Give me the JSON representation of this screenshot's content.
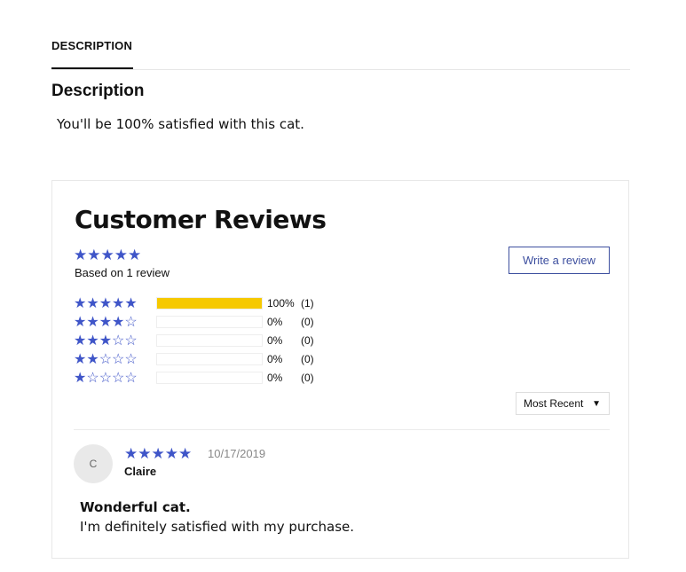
{
  "tabs": [
    {
      "label": "DESCRIPTION",
      "active": true
    }
  ],
  "description": {
    "heading": "Description",
    "text": "You'll be 100% satisfied with this cat."
  },
  "reviews": {
    "title": "Customer Reviews",
    "summary_stars": "★★★★★",
    "rating": 5,
    "based_on": "Based on 1 review",
    "write_review_label": "Write a review",
    "histogram": [
      {
        "stars": "★★★★★",
        "percent_value": 100,
        "percent": "100%",
        "count": "(1)"
      },
      {
        "stars": "★★★★☆",
        "percent_value": 0,
        "percent": "0%",
        "count": "(0)"
      },
      {
        "stars": "★★★☆☆",
        "percent_value": 0,
        "percent": "0%",
        "count": "(0)"
      },
      {
        "stars": "★★☆☆☆",
        "percent_value": 0,
        "percent": "0%",
        "count": "(0)"
      },
      {
        "stars": "★☆☆☆☆",
        "percent_value": 0,
        "percent": "0%",
        "count": "(0)"
      }
    ],
    "sort": {
      "selected": "Most Recent",
      "caret": "▼"
    },
    "items": [
      {
        "avatar_initial": "C",
        "stars": "★★★★★",
        "rating": 5,
        "date": "10/17/2019",
        "author": "Claire",
        "title": "Wonderful cat.",
        "body": "I'm definitely satisfied with my purchase."
      }
    ]
  },
  "colors": {
    "star": "#3f55c8",
    "bar_fill": "#f6c900",
    "button_border": "#3d4f9f"
  }
}
